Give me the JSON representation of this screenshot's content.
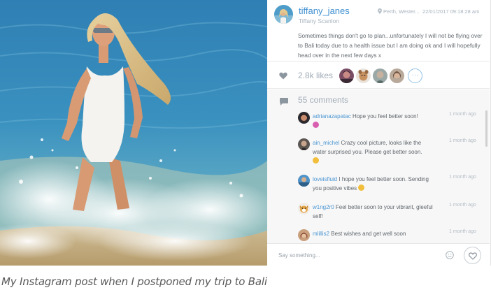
{
  "post": {
    "username": "tiffany_janes",
    "full_name": "Tiffany Scanlon",
    "location": "Perth, Wester...",
    "timestamp": "22/01/2017 09:18:28 am",
    "caption": "Sometimes things don't go to plan...unfortunately I will not be flying over to Bali today due to a health issue but I am doing ok and I will hopefully head over in the next few days x"
  },
  "likes": {
    "count_label": "2.8k likes",
    "more_label": "···"
  },
  "comments": {
    "count_label": "55 comments",
    "items": [
      {
        "user": "adrianazapatac",
        "text": "Hope you feel better soon!",
        "time": "1 month ago",
        "emoji": "sparkling-heart"
      },
      {
        "user": "ain_michel",
        "text": "Crazy cool picture, looks like the water surprised you. Please get better soon.",
        "time": "1 month ago",
        "emoji": "smiley"
      },
      {
        "user": "loveisfluid",
        "text": "I hope you feel better soon. Sending you positive vibes",
        "time": "1 month ago",
        "emoji": "smiley"
      },
      {
        "user": "w1ng2r0",
        "text": "Feel better soon to your vibrant, gleeful self!",
        "time": "1 month ago",
        "emoji": ""
      },
      {
        "user": "mlillis2",
        "text": "Best wishes and get well soon",
        "time": "1 month ago",
        "emoji": ""
      }
    ]
  },
  "compose": {
    "placeholder": "Say something..."
  },
  "icons": {
    "location": "pin-icon",
    "likes": "heart-icon",
    "comments": "comment-bubble-icon",
    "emoji": "smiley-icon",
    "like_button": "heart-outline-icon"
  },
  "colors": {
    "accent": "#3f8fd0",
    "muted": "#a2adb8",
    "comments_bg": "#f7f7f7"
  },
  "figure_caption": "My Instagram post when I postponed my trip to Bali"
}
